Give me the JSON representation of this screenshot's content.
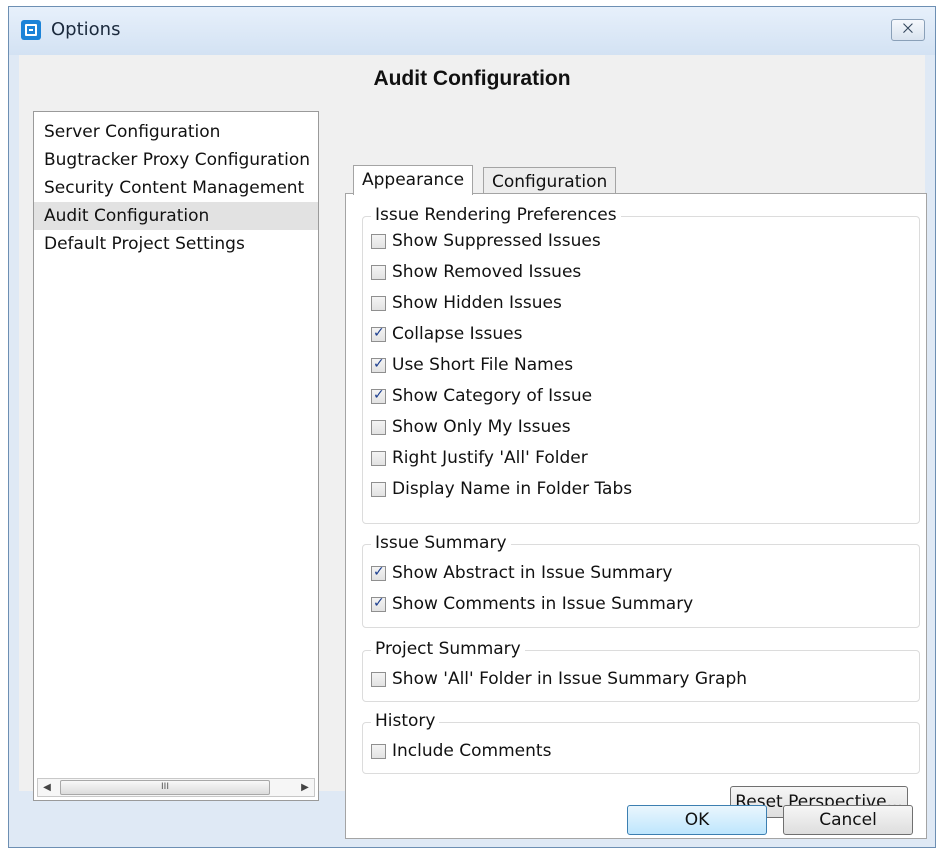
{
  "window": {
    "title": "Options",
    "close_glyph": "⨉"
  },
  "heading": "Audit Configuration",
  "nav": {
    "items": [
      {
        "label": "Server Configuration",
        "selected": false
      },
      {
        "label": "Bugtracker Proxy Configuration",
        "selected": false
      },
      {
        "label": "Security Content Management",
        "selected": false
      },
      {
        "label": "Audit Configuration",
        "selected": true
      },
      {
        "label": "Default Project Settings",
        "selected": false
      }
    ],
    "scrollbar_thumb_glyph": "III"
  },
  "tabs": [
    {
      "label": "Appearance",
      "active": true
    },
    {
      "label": "Configuration",
      "active": false
    }
  ],
  "groups": {
    "rendering": {
      "title": "Issue Rendering Preferences",
      "options": [
        {
          "label": "Show Suppressed Issues",
          "checked": false
        },
        {
          "label": "Show Removed Issues",
          "checked": false
        },
        {
          "label": "Show Hidden Issues",
          "checked": false
        },
        {
          "label": "Collapse Issues",
          "checked": true
        },
        {
          "label": "Use Short File Names",
          "checked": true
        },
        {
          "label": "Show Category of Issue",
          "checked": true
        },
        {
          "label": "Show Only My Issues",
          "checked": false
        },
        {
          "label": "Right Justify 'All' Folder",
          "checked": false
        },
        {
          "label": "Display Name in Folder Tabs",
          "checked": false
        }
      ]
    },
    "summary": {
      "title": "Issue Summary",
      "options": [
        {
          "label": "Show Abstract in Issue Summary",
          "checked": true
        },
        {
          "label": "Show Comments in Issue Summary",
          "checked": true
        }
      ]
    },
    "project": {
      "title": "Project Summary",
      "options": [
        {
          "label": "Show 'All' Folder in Issue Summary Graph",
          "checked": false
        }
      ]
    },
    "history": {
      "title": "History",
      "options": [
        {
          "label": "Include Comments",
          "checked": false
        }
      ]
    }
  },
  "buttons": {
    "reset_label": "Reset Perspective...",
    "ok_label": "OK",
    "cancel_label": "Cancel"
  },
  "icons": {
    "app": "options-app-icon",
    "close": "close-icon"
  }
}
